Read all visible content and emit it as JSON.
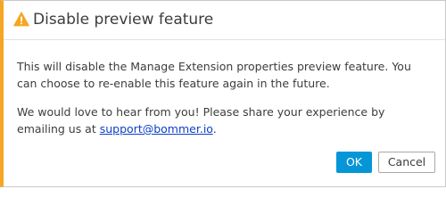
{
  "dialog": {
    "title": "Disable preview feature",
    "title_icon": "warning-triangle-icon",
    "accent_color": "#f5a623",
    "message_1": "This will disable the Manage Extension properties preview feature. You can choose to re-enable this feature again in the future.",
    "message_2_text": "We would love to hear from you! Please share your experience by emailing us at",
    "email": "support@bommer.io",
    "email_suffix": ".",
    "ok_label": "OK",
    "cancel_label": "Cancel",
    "primary_color": "#0696d7"
  }
}
